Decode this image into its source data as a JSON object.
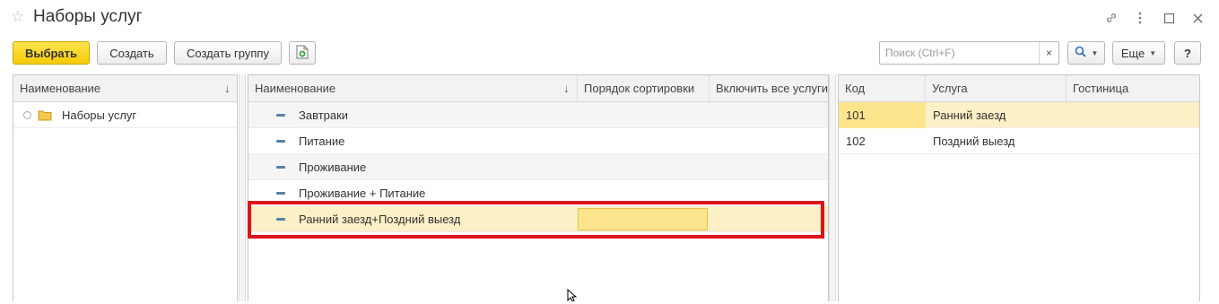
{
  "window": {
    "title": "Наборы услуг",
    "controls": [
      "link-icon",
      "more-icon",
      "maximize-icon",
      "close-icon"
    ]
  },
  "toolbar": {
    "select_label": "Выбрать",
    "create_label": "Создать",
    "create_group_label": "Создать группу",
    "search_placeholder": "Поиск (Ctrl+F)",
    "search_clear": "×",
    "more_label": "Еще",
    "help_label": "?",
    "colors": {
      "primary": "#f5cb05",
      "highlight_border": "#e0121b",
      "selected_row": "#fbf0c6",
      "selected_cell": "#fde58e"
    }
  },
  "left_panel": {
    "header": "Наименование",
    "sort_arrow": "↓",
    "items": [
      {
        "label": "Наборы услуг",
        "icon": "folder-icon"
      }
    ]
  },
  "middle_panel": {
    "columns": [
      "Наименование",
      "Порядок сортировки",
      "Включить все услуги"
    ],
    "sort_arrow": "↓",
    "rows": [
      {
        "name": "Завтраки",
        "order": "",
        "include_all": ""
      },
      {
        "name": "Питание",
        "order": "",
        "include_all": ""
      },
      {
        "name": "Проживание",
        "order": "",
        "include_all": ""
      },
      {
        "name": "Проживание + Питание",
        "order": "",
        "include_all": ""
      },
      {
        "name": "Ранний заезд+Поздний выезд",
        "order": "",
        "include_all": ""
      }
    ]
  },
  "right_panel": {
    "columns": [
      "Код",
      "Услуга",
      "Гостиница"
    ],
    "rows": [
      {
        "code": "101",
        "service": "Ранний заезд",
        "hotel": ""
      },
      {
        "code": "102",
        "service": "Поздний выезд",
        "hotel": ""
      }
    ]
  }
}
